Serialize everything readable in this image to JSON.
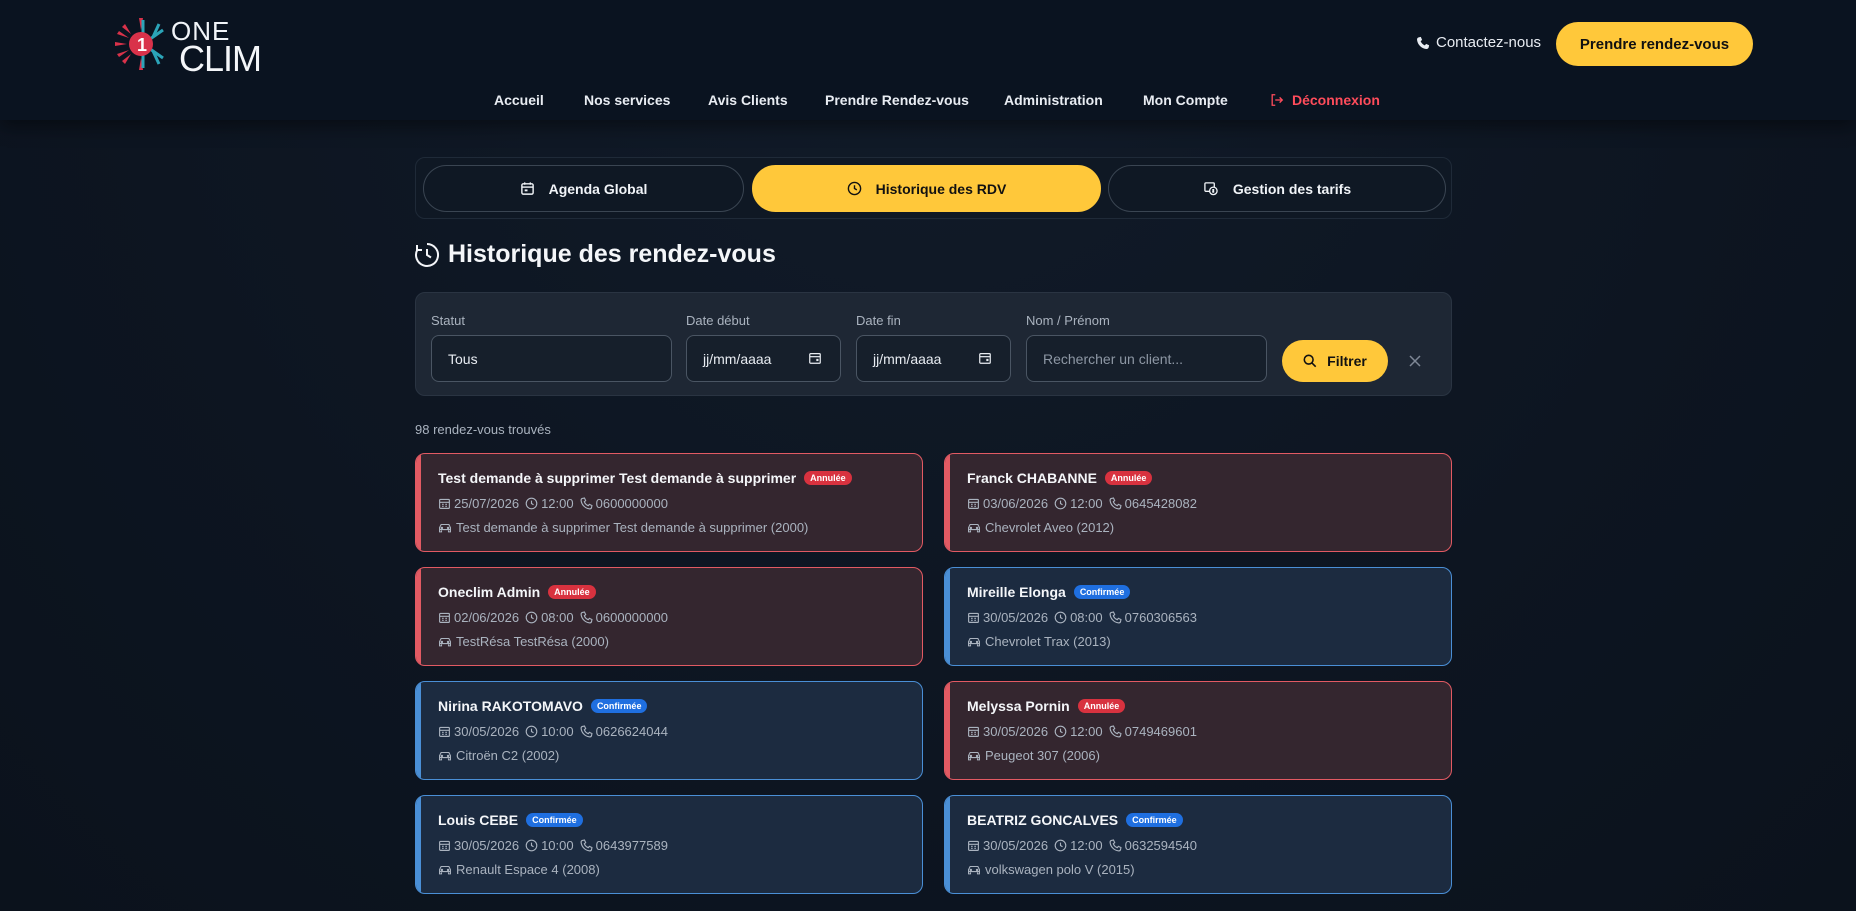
{
  "header": {
    "logo_one": "ONE",
    "logo_clim": "CLIM",
    "contact": "Contactez-nous",
    "cta": "Prendre rendez-vous",
    "nav": [
      "Accueil",
      "Nos services",
      "Avis Clients",
      "Prendre Rendez-vous",
      "Administration",
      "Mon Compte"
    ],
    "logout": "Déconnexion"
  },
  "tabs": [
    {
      "label": "Agenda Global",
      "icon": "calendar-icon"
    },
    {
      "label": "Historique des RDV",
      "icon": "clock-icon",
      "active": true
    },
    {
      "label": "Gestion des tarifs",
      "icon": "price-tag-icon"
    }
  ],
  "page_title": "Historique des rendez-vous",
  "filters": {
    "status_label": "Statut",
    "status_value": "Tous",
    "date_start_label": "Date début",
    "date_start_value": "jj/mm/aaaa",
    "date_end_label": "Date fin",
    "date_end_value": "jj/mm/aaaa",
    "name_label": "Nom / Prénom",
    "name_placeholder": "Rechercher un client...",
    "filter_button": "Filtrer"
  },
  "count": "98 rendez-vous trouvés",
  "appointments": [
    {
      "name": "Test demande à supprimer Test demande à supprimer",
      "status": "Annulée",
      "date": "25/07/2026",
      "time": "12:00",
      "phone": "0600000000",
      "car": "Test demande à supprimer Test demande à supprimer (2000)"
    },
    {
      "name": "Franck CHABANNE",
      "status": "Annulée",
      "date": "03/06/2026",
      "time": "12:00",
      "phone": "0645428082",
      "car": "Chevrolet Aveo (2012)"
    },
    {
      "name": "Oneclim Admin",
      "status": "Annulée",
      "date": "02/06/2026",
      "time": "08:00",
      "phone": "0600000000",
      "car": "TestRésa TestRésa (2000)"
    },
    {
      "name": "Mireille Elonga",
      "status": "Confirmée",
      "date": "30/05/2026",
      "time": "08:00",
      "phone": "0760306563",
      "car": "Chevrolet Trax (2013)"
    },
    {
      "name": "Nirina RAKOTOMAVO",
      "status": "Confirmée",
      "date": "30/05/2026",
      "time": "10:00",
      "phone": "0626624044",
      "car": "Citroën C2 (2002)"
    },
    {
      "name": "Melyssa Pornin",
      "status": "Annulée",
      "date": "30/05/2026",
      "time": "12:00",
      "phone": "0749469601",
      "car": "Peugeot 307 (2006)"
    },
    {
      "name": "Louis CEBE",
      "status": "Confirmée",
      "date": "30/05/2026",
      "time": "10:00",
      "phone": "0643977589",
      "car": "Renault Espace 4 (2008)"
    },
    {
      "name": "BEATRIZ GONCALVES",
      "status": "Confirmée",
      "date": "30/05/2026",
      "time": "12:00",
      "phone": "0632594540",
      "car": "volkswagen polo V (2015)"
    }
  ],
  "colors": {
    "accent": "#ffc83a",
    "cancel": "#e25a63",
    "confirm": "#4a8fd6",
    "logout": "#ff4c5b"
  }
}
